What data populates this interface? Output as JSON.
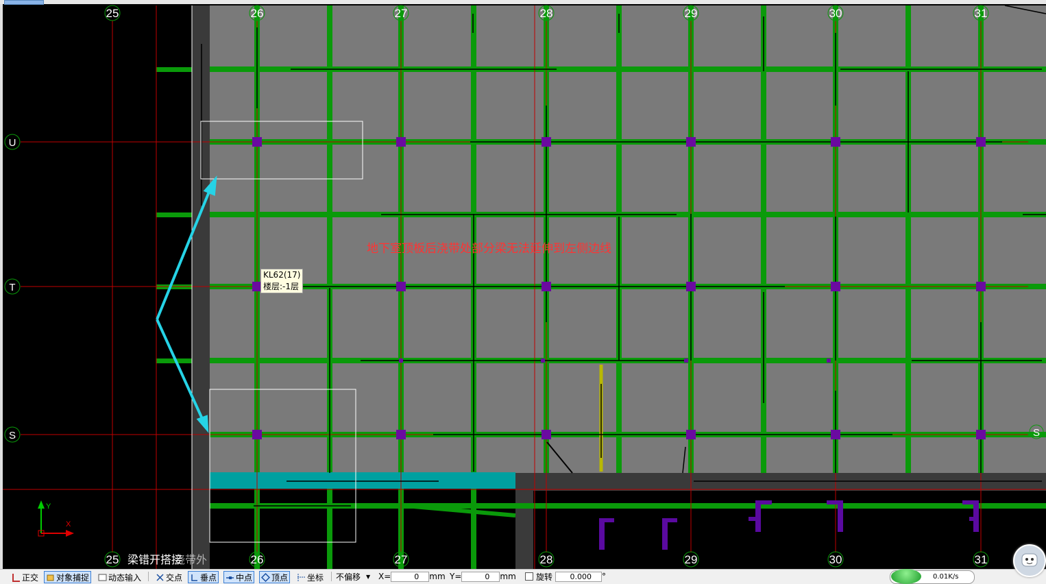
{
  "canvas": {
    "axes_top": [
      "25",
      "26",
      "27",
      "28",
      "29",
      "30",
      "31"
    ],
    "axes_bottom": [
      "25",
      "26",
      "27",
      "28",
      "29",
      "30",
      "31"
    ],
    "axes_left": [
      "U",
      "T",
      "S"
    ],
    "axis_right": "S",
    "annotation": "地下室顶板后浇带处部分梁无法延伸到左侧边线",
    "bottom_label": "梁错开搭接",
    "bottom_label_overlay": "浇带外",
    "tooltip": {
      "name": "KL62(17)",
      "floor": "楼层:-1层"
    },
    "ucs": {
      "x": "X",
      "y": "Y"
    }
  },
  "statusbar": {
    "ortho": "正交",
    "snap": "对象捕捉",
    "dynamic_input": "动态输入",
    "intersection": "交点",
    "perpendicular": "垂点",
    "midpoint": "中点",
    "vertex": "顶点",
    "coordinate": "坐标",
    "offset_mode": "不偏移",
    "x_label": "X=",
    "x_value": "0",
    "mm1": "mm",
    "y_label": "Y=",
    "y_value": "0",
    "mm2": "mm",
    "rotate": "旋转",
    "rotate_value": "0.000",
    "deg": "°",
    "speed": "0.01K/s"
  },
  "colors": {
    "background": "#000000",
    "slab": "#7a7a7a",
    "beam": "#0a9a0a",
    "column": "#6a0aa0",
    "axis_line": "#c00000",
    "highlight": "#00aaaa",
    "arrow": "#26d3e6"
  }
}
